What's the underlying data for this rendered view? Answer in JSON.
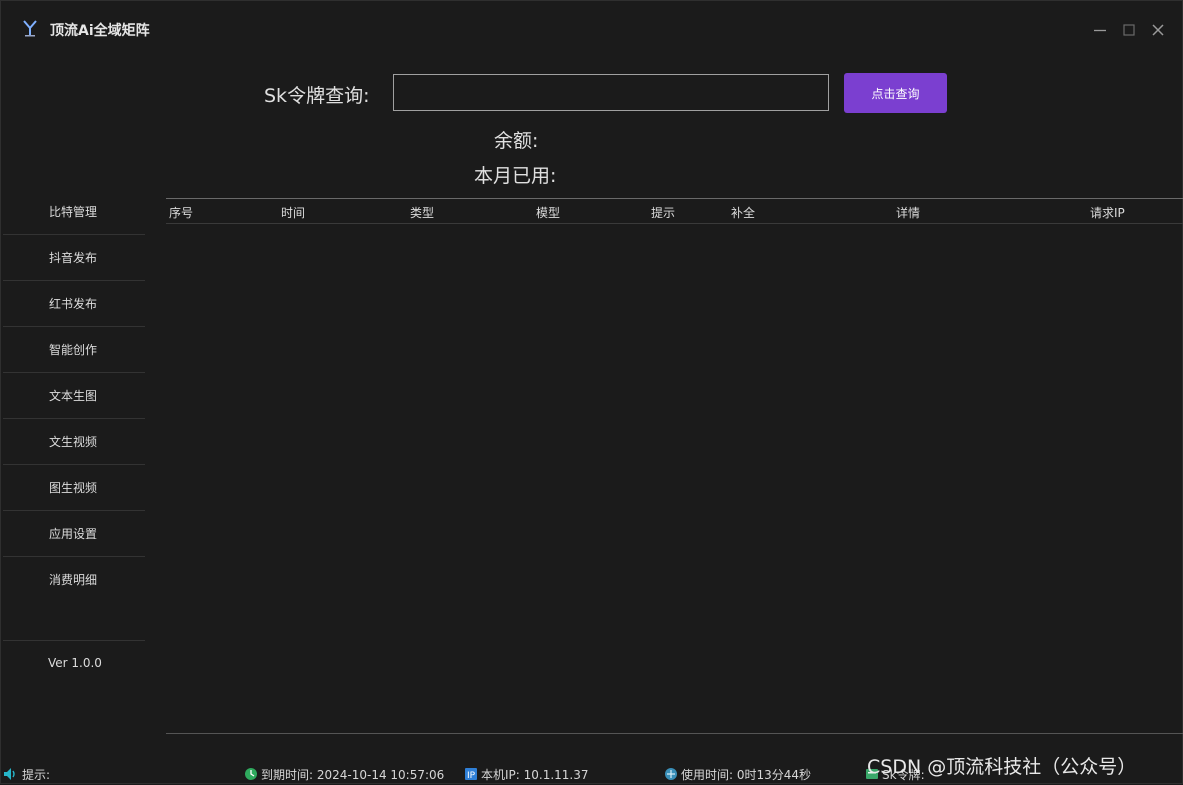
{
  "window": {
    "title": "顶流Ai全域矩阵"
  },
  "query": {
    "label": "Sk令牌查询:",
    "input_value": "",
    "input_placeholder": "",
    "button_label": "点击查询",
    "balance_label": "余额:",
    "month_used_label": "本月已用:"
  },
  "sidebar": {
    "items": [
      {
        "label": "比特管理"
      },
      {
        "label": "抖音发布"
      },
      {
        "label": "红书发布"
      },
      {
        "label": "智能创作"
      },
      {
        "label": "文本生图"
      },
      {
        "label": "文生视频"
      },
      {
        "label": "图生视频"
      },
      {
        "label": "应用设置"
      },
      {
        "label": "消费明细"
      }
    ],
    "version": "Ver 1.0.0"
  },
  "table": {
    "columns": [
      "序号",
      "时间",
      "类型",
      "模型",
      "提示",
      "补全",
      "详情",
      "请求IP"
    ],
    "rows": []
  },
  "statusbar": {
    "hint": "提示:",
    "expire": "到期时间: 2024-10-14 10:57:06",
    "local_ip": "本机IP: 10.1.11.37",
    "usage_time": "使用时间: 0时13分44秒",
    "sk_token": "Sk令牌:"
  },
  "watermark": "CSDN @顶流科技社（公众号）",
  "colors": {
    "background": "#1b1b1b",
    "accent": "#7b3fd0",
    "text": "#dcdcdc"
  }
}
